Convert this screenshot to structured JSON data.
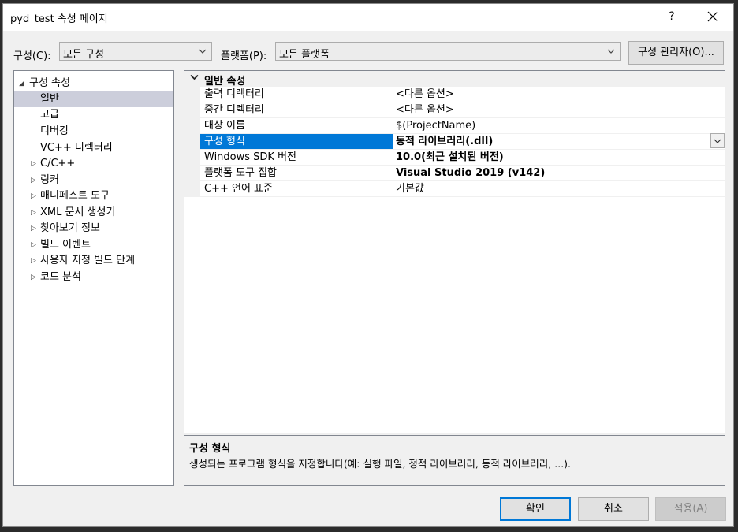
{
  "window": {
    "title": "pyd_test 속성 페이지",
    "help_label": "?"
  },
  "toolbar": {
    "config_label": "구성(C):",
    "config_value": "모든 구성",
    "platform_label": "플랫폼(P):",
    "platform_value": "모든 플랫폼",
    "config_manager_label": "구성 관리자(O)..."
  },
  "tree": {
    "root_label": "구성 속성",
    "items": [
      {
        "label": "일반",
        "selected": true
      },
      {
        "label": "고급"
      },
      {
        "label": "디버깅"
      },
      {
        "label": "VC++ 디렉터리"
      },
      {
        "label": "C/C++"
      },
      {
        "label": "링커"
      },
      {
        "label": "매니페스트 도구"
      },
      {
        "label": "XML 문서 생성기"
      },
      {
        "label": "찾아보기 정보"
      },
      {
        "label": "빌드 이벤트"
      },
      {
        "label": "사용자 지정 빌드 단계"
      },
      {
        "label": "코드 분석"
      }
    ]
  },
  "grid": {
    "category": "일반 속성",
    "rows": [
      {
        "name": "출력 디렉터리",
        "value": "<다른 옵션>"
      },
      {
        "name": "중간 디렉터리",
        "value": "<다른 옵션>"
      },
      {
        "name": "대상 이름",
        "value": "$(ProjectName)"
      },
      {
        "name": "구성 형식",
        "value": "동적 라이브러리(.dll)",
        "selected": true,
        "bold": true
      },
      {
        "name": "Windows SDK 버전",
        "value": "10.0(최근 설치된 버전)",
        "bold": true
      },
      {
        "name": "플랫폼 도구 집합",
        "value": "Visual Studio 2019 (v142)",
        "bold": true
      },
      {
        "name": "C++ 언어 표준",
        "value": "기본값"
      }
    ]
  },
  "description": {
    "title": "구성 형식",
    "text": "생성되는 프로그램 형식을 지정합니다(예: 실행 파일, 정적 라이브러리, 동적 라이브러리, ...)."
  },
  "buttons": {
    "ok": "확인",
    "cancel": "취소",
    "apply": "적용(A)"
  },
  "colors": {
    "selection": "#0078d7",
    "tree_selection": "#cccedb"
  }
}
